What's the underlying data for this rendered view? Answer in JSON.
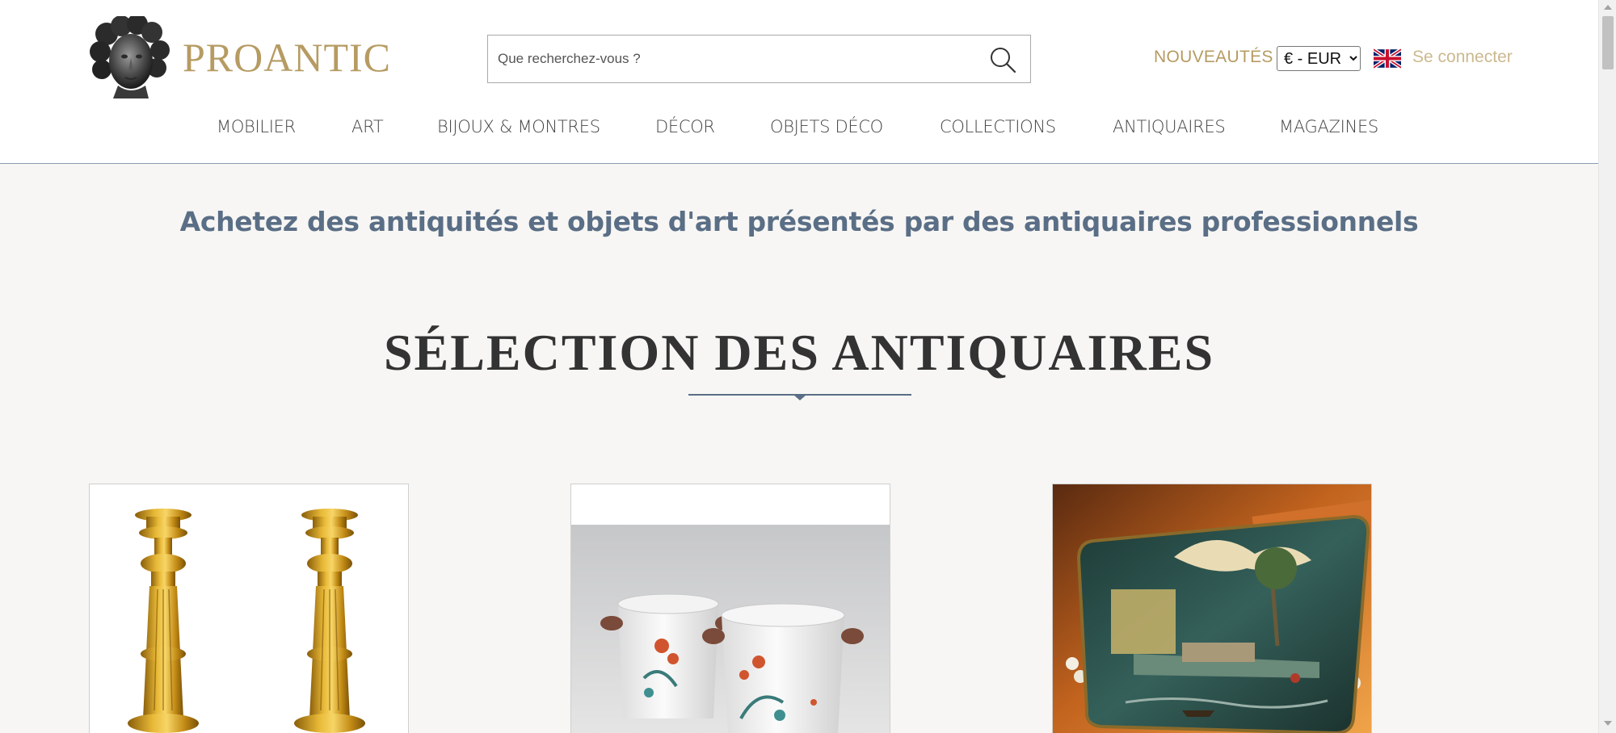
{
  "brand": {
    "name": "PROANTIC",
    "color": "#b69b62"
  },
  "search": {
    "placeholder": "Que recherchez-vous ?"
  },
  "header_links": {
    "nouveautes": "NOUVEAUTÉS",
    "login": "Se connecter"
  },
  "currency": {
    "selected": "€ - EUR"
  },
  "nav": {
    "items": [
      {
        "label": "MOBILIER"
      },
      {
        "label": "ART"
      },
      {
        "label": "BIJOUX & MONTRES"
      },
      {
        "label": "DÉCOR"
      },
      {
        "label": "OBJETS DÉCO"
      },
      {
        "label": "COLLECTIONS"
      },
      {
        "label": "ANTIQUAIRES"
      },
      {
        "label": "MAGAZINES"
      }
    ]
  },
  "main": {
    "tagline": "Achetez des antiquités et objets d'art présentés par des antiquaires professionnels",
    "section_title": "SÉLECTION DES ANTIQUAIRES"
  },
  "icons": {
    "search": "magnifier-icon",
    "flag": "uk-flag-icon",
    "logo": "classical-bust-logo"
  },
  "products": [
    {
      "image": "gilt-bronze-candlesticks"
    },
    {
      "image": "porcelain-wine-coolers"
    },
    {
      "image": "painted-lacquer-box"
    }
  ]
}
